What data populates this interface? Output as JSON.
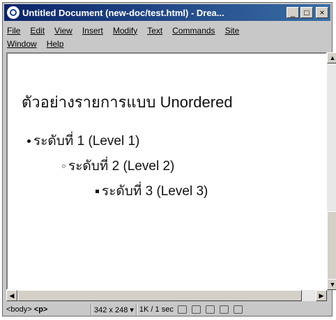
{
  "window": {
    "title": "Untitled Document (new-doc/test.html) - Drea...",
    "controls": {
      "minimize": "_",
      "maximize": "□",
      "close": "×"
    }
  },
  "menu": {
    "row1": [
      "File",
      "Edit",
      "View",
      "Insert",
      "Modify",
      "Text",
      "Commands",
      "Site"
    ],
    "row2": [
      "Window",
      "Help"
    ]
  },
  "document": {
    "heading": "ตัวอย่างรายการแบบ Unordered",
    "items": [
      "ระดับที่ 1 (Level 1)",
      "ระดับที่ 2 (Level 2)",
      "ระดับที่ 3 (Level 3)"
    ]
  },
  "scrollbars": {
    "up": "▲",
    "down": "▼",
    "left": "◀",
    "right": "▶"
  },
  "statusbar": {
    "tag_body": "<body>",
    "tag_p": "<p>",
    "window_size": "342 x 248 ▾",
    "download": "1K / 1 sec"
  }
}
